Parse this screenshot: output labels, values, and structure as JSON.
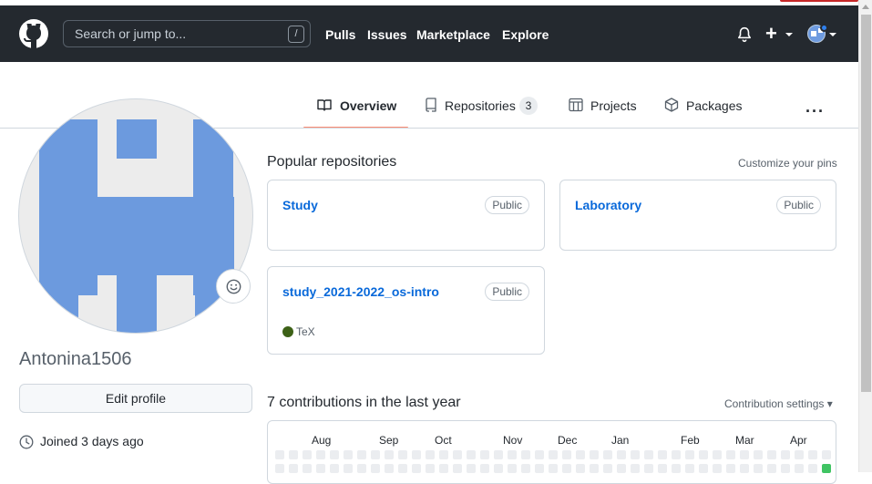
{
  "header": {
    "search_placeholder": "Search or jump to...",
    "search_shortcut": "/",
    "nav": [
      "Pulls",
      "Issues",
      "Marketplace",
      "Explore"
    ],
    "plus": "+"
  },
  "tabs": {
    "overview": "Overview",
    "repositories": "Repositories",
    "repositories_count": "3",
    "projects": "Projects",
    "packages": "Packages",
    "more": "···"
  },
  "profile": {
    "username": "Antonina1506",
    "edit_label": "Edit profile",
    "joined": "Joined 3 days ago",
    "avatar_color": "#6c9ade"
  },
  "popular": {
    "title": "Popular repositories",
    "customize": "Customize your pins",
    "repos": [
      {
        "name": "Study",
        "visibility": "Public",
        "language": ""
      },
      {
        "name": "Laboratory",
        "visibility": "Public",
        "language": ""
      },
      {
        "name": "study_2021-2022_os-intro",
        "visibility": "Public",
        "language": "TeX",
        "language_color": "#3d6117"
      }
    ]
  },
  "contributions": {
    "title": "7 contributions in the last year",
    "settings": "Contribution settings ▾",
    "months": [
      "Aug",
      "Sep",
      "Oct",
      "Nov",
      "Dec",
      "Jan",
      "Feb",
      "Mar",
      "Apr"
    ],
    "empty_color": "#ebedf0",
    "active_color": "#40c463"
  }
}
